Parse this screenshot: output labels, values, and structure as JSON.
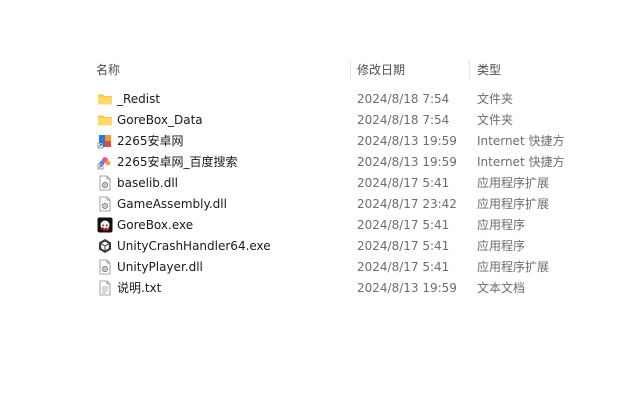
{
  "columns": {
    "name": "名称",
    "date": "修改日期",
    "type": "类型"
  },
  "files": [
    {
      "name": "_Redist",
      "date": "2024/8/18 7:54",
      "type": "文件夹",
      "icon": "folder-icon"
    },
    {
      "name": "GoreBox_Data",
      "date": "2024/8/18 7:54",
      "type": "文件夹",
      "icon": "folder-icon"
    },
    {
      "name": "2265安卓网",
      "date": "2024/8/13 19:59",
      "type": "Internet 快捷方",
      "icon": "internet-shortcut-icon"
    },
    {
      "name": "2265安卓网_百度搜索",
      "date": "2024/8/13 19:59",
      "type": "Internet 快捷方",
      "icon": "internet-shortcut-icon"
    },
    {
      "name": "baselib.dll",
      "date": "2024/8/17 5:41",
      "type": "应用程序扩展",
      "icon": "dll-file-icon"
    },
    {
      "name": "GameAssembly.dll",
      "date": "2024/8/17 23:42",
      "type": "应用程序扩展",
      "icon": "dll-file-icon"
    },
    {
      "name": "GoreBox.exe",
      "date": "2024/8/17 5:41",
      "type": "应用程序",
      "icon": "gorebox-app-icon"
    },
    {
      "name": "UnityCrashHandler64.exe",
      "date": "2024/8/17 5:41",
      "type": "应用程序",
      "icon": "unity-app-icon"
    },
    {
      "name": "UnityPlayer.dll",
      "date": "2024/8/17 5:41",
      "type": "应用程序扩展",
      "icon": "dll-file-icon"
    },
    {
      "name": "说明.txt",
      "date": "2024/8/13 19:59",
      "type": "文本文档",
      "icon": "text-file-icon"
    }
  ]
}
